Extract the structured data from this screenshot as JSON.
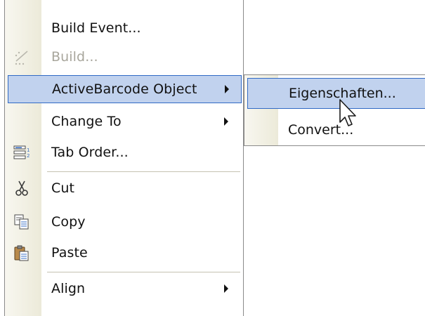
{
  "context_menu": {
    "items": [
      {
        "label": "Build Event...",
        "state": "normal"
      },
      {
        "label": "Build...",
        "state": "disabled",
        "icon": "build-wand-icon"
      },
      {
        "label": "ActiveBarcode Object",
        "state": "selected",
        "has_submenu": true
      },
      {
        "label": "Change To",
        "state": "normal",
        "has_submenu": true
      },
      {
        "label": "Tab Order...",
        "state": "normal",
        "icon": "tab-order-icon"
      },
      {
        "label": "Cut",
        "state": "normal",
        "icon": "scissors-icon"
      },
      {
        "label": "Copy",
        "state": "normal",
        "icon": "copy-icon"
      },
      {
        "label": "Paste",
        "state": "normal",
        "icon": "clipboard-paste-icon"
      },
      {
        "label": "Align",
        "state": "normal",
        "has_submenu": true
      }
    ]
  },
  "submenu": {
    "parent": "ActiveBarcode Object",
    "items": [
      {
        "label": "Eigenschaften...",
        "state": "selected"
      },
      {
        "label": "Convert...",
        "state": "normal"
      }
    ]
  },
  "colors": {
    "highlight_fill": "#c1d2ee",
    "highlight_border": "#316ac5",
    "gutter": "#ecead9",
    "disabled_text": "#a8a69c"
  }
}
